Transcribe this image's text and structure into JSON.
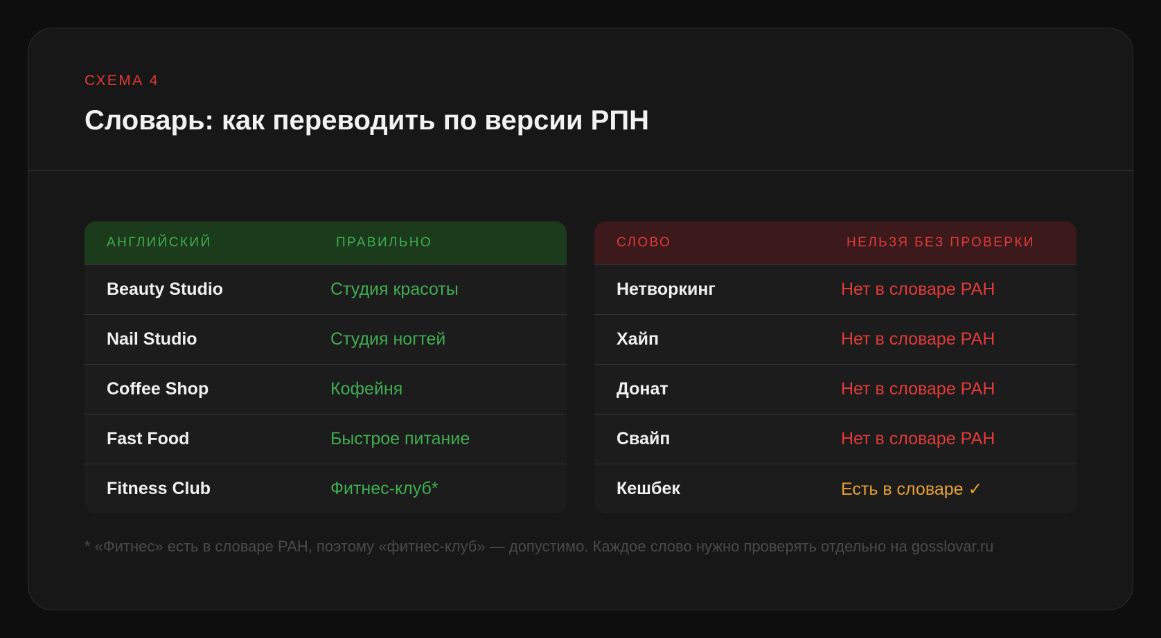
{
  "header": {
    "eyebrow": "СХЕМА 4",
    "title": "Словарь: как переводить по версии РПН"
  },
  "left_table": {
    "col1": "АНГЛИЙСКИЙ",
    "col2": "ПРАВИЛЬНО",
    "rows": [
      {
        "en": "Beauty Studio",
        "ru": "Студия красоты"
      },
      {
        "en": "Nail Studio",
        "ru": "Студия ногтей"
      },
      {
        "en": "Coffee Shop",
        "ru": "Кофейня"
      },
      {
        "en": "Fast Food",
        "ru": "Быстрое питание"
      },
      {
        "en": "Fitness Club",
        "ru": "Фитнес-клуб*"
      }
    ]
  },
  "right_table": {
    "col1": "СЛОВО",
    "col2": "НЕЛЬЗЯ БЕЗ ПРОВЕРКИ",
    "rows": [
      {
        "word": "Нетворкинг",
        "status": "Нет в словаре РАН"
      },
      {
        "word": "Хайп",
        "status": "Нет в словаре РАН"
      },
      {
        "word": "Донат",
        "status": "Нет в словаре РАН"
      },
      {
        "word": "Свайп",
        "status": "Нет в словаре РАН"
      },
      {
        "word": "Кешбек",
        "status": "Есть в словаре ✓"
      }
    ]
  },
  "footnote": "* «Фитнес» есть в словаре РАН, поэтому «фитнес-клуб» — допустимо. Каждое слово нужно проверять отдельно на gosslovar.ru",
  "colors": {
    "accent_red": "#e33a3a",
    "accent_green": "#3fae52",
    "accent_amber": "#e8a030",
    "background": "#171717"
  }
}
